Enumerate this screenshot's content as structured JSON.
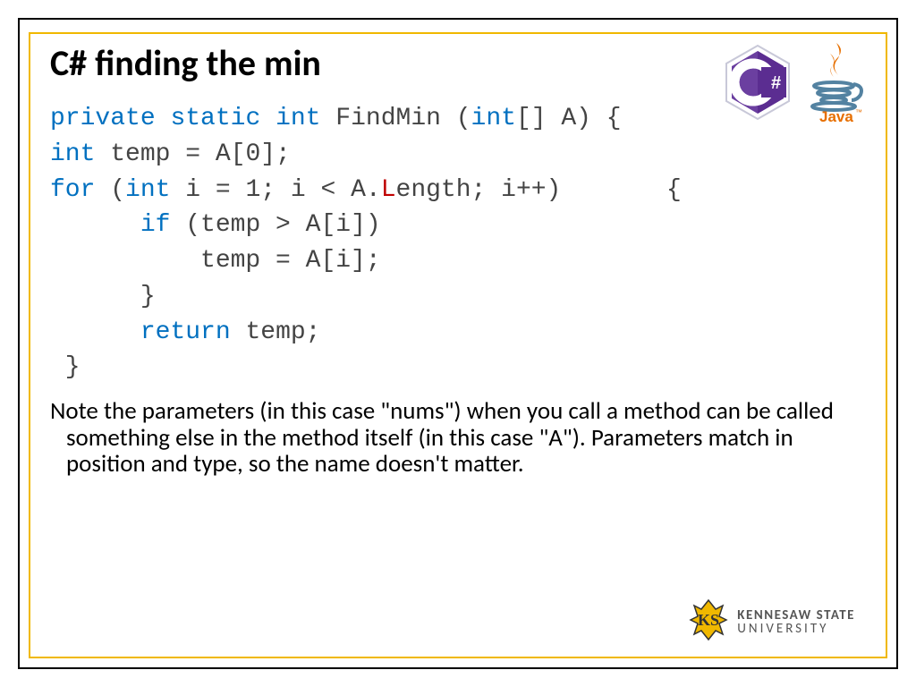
{
  "title": "C#  finding the min",
  "code": {
    "line1": {
      "kw1": "private",
      "kw2": "static",
      "kw3": "int",
      "fn": " FindMin (",
      "kw4": "int",
      "rest": "[] A) {"
    },
    "line2": {
      "kw1": "int",
      "rest": " temp = A[0];"
    },
    "line3": {
      "kw1": "for",
      "p1": " (",
      "kw2": "int",
      "mid": " i = 1; i < A.",
      "red": "L",
      "rest": "ength; i++)       {"
    },
    "line4": {
      "indent": "      ",
      "kw1": "if",
      "rest": " (temp > A[i])"
    },
    "line5": "          temp = A[i];",
    "line6": "      }",
    "line7": {
      "indent": "      ",
      "kw1": "return",
      "rest": " temp;"
    },
    "line8": " }"
  },
  "note": "Note the parameters (in this case \"nums\") when you call a method can be called something else in the method itself (in this case \"A\").  Parameters match in position and type, so the name doesn't matter.",
  "icons": {
    "csharp": "csharp-icon",
    "java": "java-icon",
    "ksu": "ksu-icon"
  },
  "ksu": {
    "l1": "KENNESAW STATE",
    "l2": "UNIVERSITY"
  }
}
